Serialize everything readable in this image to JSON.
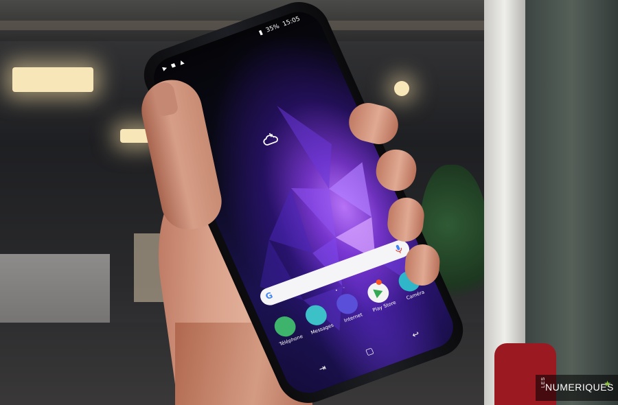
{
  "photo": {
    "subject": "Hand holding a Samsung Galaxy S9 smartphone",
    "background": "blurred office interior with ceiling lights, pillar and plant"
  },
  "phone": {
    "status_bar": {
      "notification_icons": "▶ ◼ ▲",
      "battery": "35%",
      "time": "15:05"
    },
    "search": {
      "google_letter": "G"
    },
    "home_dots": "• ◦",
    "dock_apps": [
      {
        "label": "Téléphone",
        "color": "#3db36b",
        "icon": "phone-icon"
      },
      {
        "label": "Messages",
        "color": "#3cc1c9",
        "icon": "chat-icon"
      },
      {
        "label": "Internet",
        "color": "#5a4fd9",
        "icon": "planet-icon"
      },
      {
        "label": "Play Store",
        "color": "#f3f3f3",
        "icon": "play-store-icon"
      },
      {
        "label": "Caméra",
        "color": "#2fb6c9",
        "icon": "camera-icon"
      }
    ],
    "navbar": {
      "recent": "⇥",
      "home": "▢",
      "back": "↩"
    },
    "accent": "#8a4cff"
  },
  "watermark": {
    "prefix": "LES",
    "name": "NUMERIQUES",
    "star": "★"
  }
}
